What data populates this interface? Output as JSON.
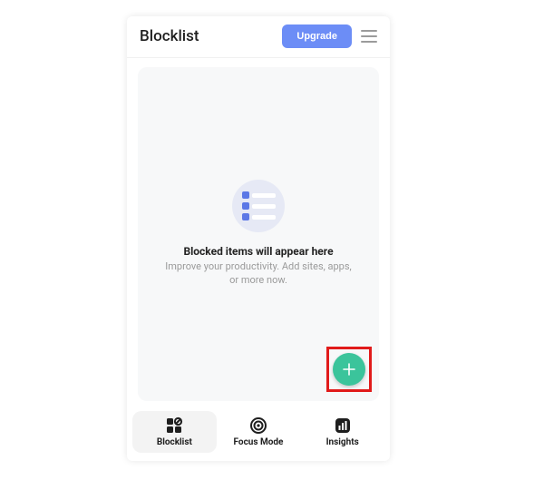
{
  "header": {
    "title": "Blocklist",
    "upgrade_label": "Upgrade"
  },
  "empty_state": {
    "title": "Blocked items will appear here",
    "subtitle": "Improve your productivity. Add sites, apps, or more now."
  },
  "nav": {
    "items": [
      {
        "label": "Blocklist"
      },
      {
        "label": "Focus Mode"
      },
      {
        "label": "Insights"
      }
    ]
  }
}
